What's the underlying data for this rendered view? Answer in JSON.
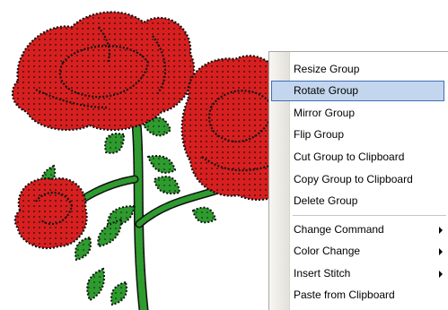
{
  "menu": {
    "items": [
      {
        "label": "Resize Group",
        "highlighted": false,
        "submenu": false
      },
      {
        "label": "Rotate Group",
        "highlighted": true,
        "submenu": false
      },
      {
        "label": "Mirror Group",
        "highlighted": false,
        "submenu": false
      },
      {
        "label": "Flip Group",
        "highlighted": false,
        "submenu": false
      },
      {
        "label": "Cut Group to Clipboard",
        "highlighted": false,
        "submenu": false
      },
      {
        "label": "Copy Group to Clipboard",
        "highlighted": false,
        "submenu": false
      },
      {
        "label": "Delete Group",
        "highlighted": false,
        "submenu": false
      },
      {
        "label": "Change Command",
        "highlighted": false,
        "submenu": true
      },
      {
        "label": "Color Change",
        "highlighted": false,
        "submenu": true
      },
      {
        "label": "Insert Stitch",
        "highlighted": false,
        "submenu": true
      },
      {
        "label": "Paste from Clipboard",
        "highlighted": false,
        "submenu": false
      }
    ]
  },
  "colors": {
    "rose_red": "#d81f1f",
    "leaf_green": "#2e9b2e",
    "stitch_black": "#000000",
    "highlight_fill": "#c4d6ee",
    "highlight_border": "#3d6eb8"
  }
}
